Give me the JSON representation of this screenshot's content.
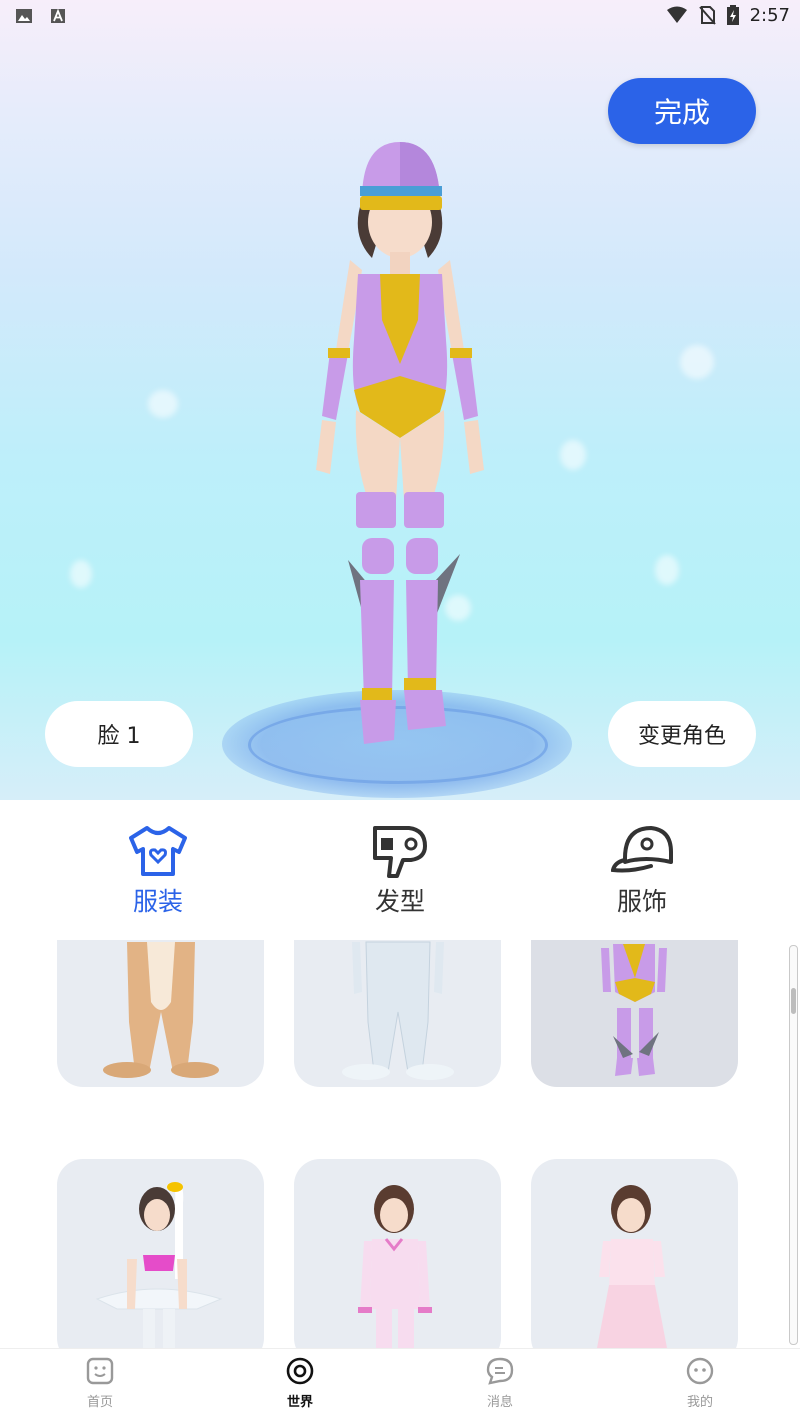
{
  "status_bar": {
    "time": "2:57",
    "left_icons": [
      "image-icon",
      "a-letter-icon"
    ],
    "right_icons": [
      "wifi-icon",
      "no-sim-icon",
      "battery-charging-icon"
    ]
  },
  "stage": {
    "done_label": "完成",
    "face_label": "脸 1",
    "change_character_label": "变更角色"
  },
  "category_tabs": [
    {
      "label": "服装",
      "icon": "tshirt-icon",
      "active": true
    },
    {
      "label": "发型",
      "icon": "hair-dryer-icon",
      "active": false
    },
    {
      "label": "服饰",
      "icon": "cap-icon",
      "active": false
    }
  ],
  "outfits": [
    {
      "name": "bear-costume",
      "selected": false
    },
    {
      "name": "white-bodysuit",
      "selected": false
    },
    {
      "name": "purple-gold-armor",
      "selected": true
    },
    {
      "name": "swan-costume",
      "selected": false
    },
    {
      "name": "pink-pajamas",
      "selected": false
    },
    {
      "name": "pink-dress",
      "selected": false
    }
  ],
  "bottom_nav": [
    {
      "label": "首页",
      "icon": "home-face-icon",
      "active": false
    },
    {
      "label": "世界",
      "icon": "world-circle-icon",
      "active": true
    },
    {
      "label": "消息",
      "icon": "message-bubble-icon",
      "active": false
    },
    {
      "label": "我的",
      "icon": "profile-face-icon",
      "active": false
    }
  ],
  "colors": {
    "accent": "#2b63e8",
    "nav_inactive": "#999999",
    "card_bg": "#e8ecf2"
  }
}
